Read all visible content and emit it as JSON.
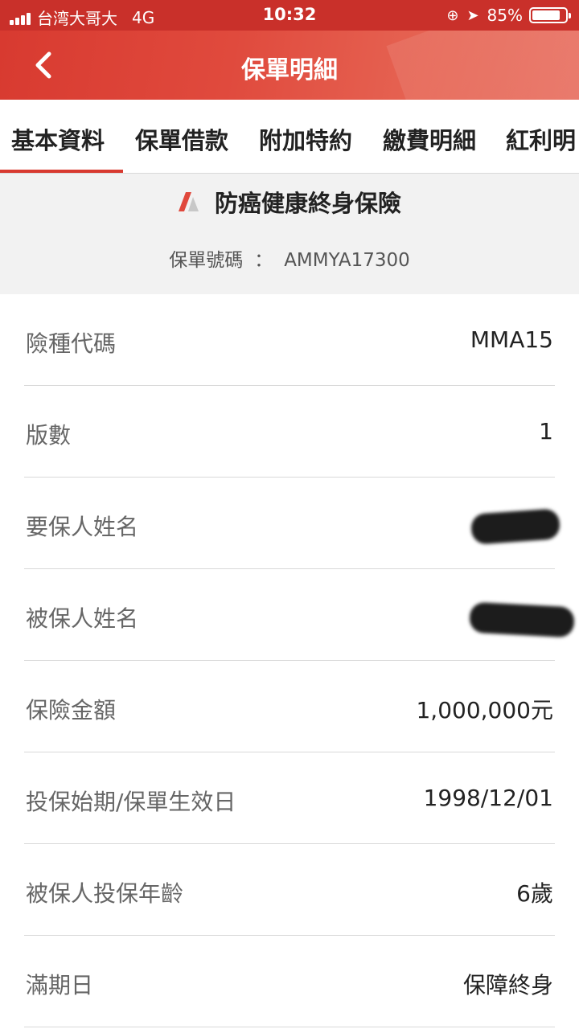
{
  "status_bar": {
    "carrier": "台湾大哥大",
    "network": "4G",
    "time": "10:32",
    "battery_percent": "85%",
    "battery_level": 0.85
  },
  "header": {
    "title": "保單明細",
    "back_icon": "chevron-left-icon"
  },
  "tabs": [
    {
      "label": "基本資料",
      "active": true
    },
    {
      "label": "保單借款",
      "active": false
    },
    {
      "label": "附加特約",
      "active": false
    },
    {
      "label": "繳費明細",
      "active": false
    },
    {
      "label": "紅利明",
      "active": false
    }
  ],
  "policy": {
    "name": "防癌健康終身保險",
    "number_label": "保單號碼",
    "number_sep": "：",
    "number": "AMMYA17300"
  },
  "details": [
    {
      "label": "險種代碼",
      "value": "MMA15"
    },
    {
      "label": "版數",
      "value": "1"
    },
    {
      "label": "要保人姓名",
      "value": "",
      "redacted": true
    },
    {
      "label": "被保人姓名",
      "value": "",
      "redacted": true
    },
    {
      "label": "保險金額",
      "value": "1,000,000元"
    },
    {
      "label": "投保始期/保單生效日",
      "value": "1998/12/01"
    },
    {
      "label": "被保人投保年齡",
      "value": "6歲"
    },
    {
      "label": "滿期日",
      "value": "保障終身"
    }
  ],
  "colors": {
    "brand_red": "#d83a30",
    "status_bar": "#c9302a"
  }
}
